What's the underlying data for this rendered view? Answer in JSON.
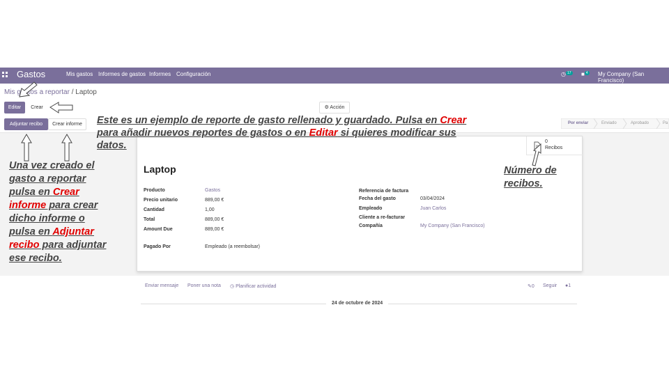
{
  "navbar": {
    "brand": "Gastos",
    "menu": [
      "Mis gastos",
      "Informes de gastos",
      "Informes",
      "Configuración"
    ],
    "activity_count": "17",
    "message_count": "4",
    "company": "My Company (San Francisco)"
  },
  "breadcrumb": {
    "parent": "Mis gastos a reportar",
    "separator": "/",
    "current": "Laptop"
  },
  "toolbar": {
    "edit_label": "Editar",
    "create_label": "Crear",
    "action_label": "Acción"
  },
  "statusbar": {
    "attach_receipt_label": "Adjuntar recibo",
    "create_report_label": "Crear informe",
    "stages": [
      "Por enviar",
      "Enviado",
      "Aprobado",
      "Pa"
    ]
  },
  "smart_button": {
    "count": "0",
    "label": "Recibos"
  },
  "record": {
    "title": "Laptop",
    "left_fields": [
      {
        "label": "Producto",
        "value": "Gastos",
        "link": true
      },
      {
        "label": "Precio unitario",
        "value": "889,00 €",
        "link": false
      },
      {
        "label": "Cantidad",
        "value": "1,00",
        "link": false
      },
      {
        "label": "Total",
        "value": "889,00 €",
        "link": false
      },
      {
        "label": "Amount Due",
        "value": "889,00 €",
        "link": false
      }
    ],
    "paid_by_label": "Pagado Por",
    "paid_by_value": "Empleado (a reembolsar)",
    "right_fields": [
      {
        "label": "Referencia de factura",
        "value": ""
      },
      {
        "label": "Fecha del gasto",
        "value": "03/04/2024"
      },
      {
        "label": "Empleado",
        "value": "Juan Carlos"
      },
      {
        "label": "Cliente a re-facturar",
        "value": ""
      },
      {
        "label": "Compañía",
        "value": "My Company (San Francisco)"
      }
    ]
  },
  "chatter": {
    "send_message": "Enviar mensaje",
    "log_note": "Poner una nota",
    "schedule_activity": "Planificar actividad",
    "attachments_count": "0",
    "follow": "Seguir",
    "followers_count": "1",
    "date": "24 de octubre de 2024"
  },
  "annotations": {
    "top_line1_pre": "Este es un ejemplo de reporte de gasto rellenado y guardado. Pulsa en ",
    "top_line1_hl": "Crear",
    "top_line2_pre": "para añadir nuevos reportes de gastos o en ",
    "top_line2_hl": "Editar",
    "top_line2_post": " si quieres modificar sus",
    "top_line3": "datos.",
    "left_l1": "Una vez creado el",
    "left_l2": "gasto a reportar",
    "left_l3_pre": "pulsa en ",
    "left_l3_hl": "Crear",
    "left_l4_hl": "informe",
    "left_l4_post": " para crear",
    "left_l5": "dicho informe o",
    "left_l6_pre": "pulsa en ",
    "left_l6_hl": "Adjuntar",
    "left_l7_hl": "recibo",
    "left_l7_post": " para adjuntar",
    "left_l8": "ese recibo.",
    "right_l1": "Número de",
    "right_l2": "recibos."
  },
  "colors": {
    "brand": "#7a6f9b",
    "highlight": "#e00000",
    "annotation": "#444444"
  }
}
